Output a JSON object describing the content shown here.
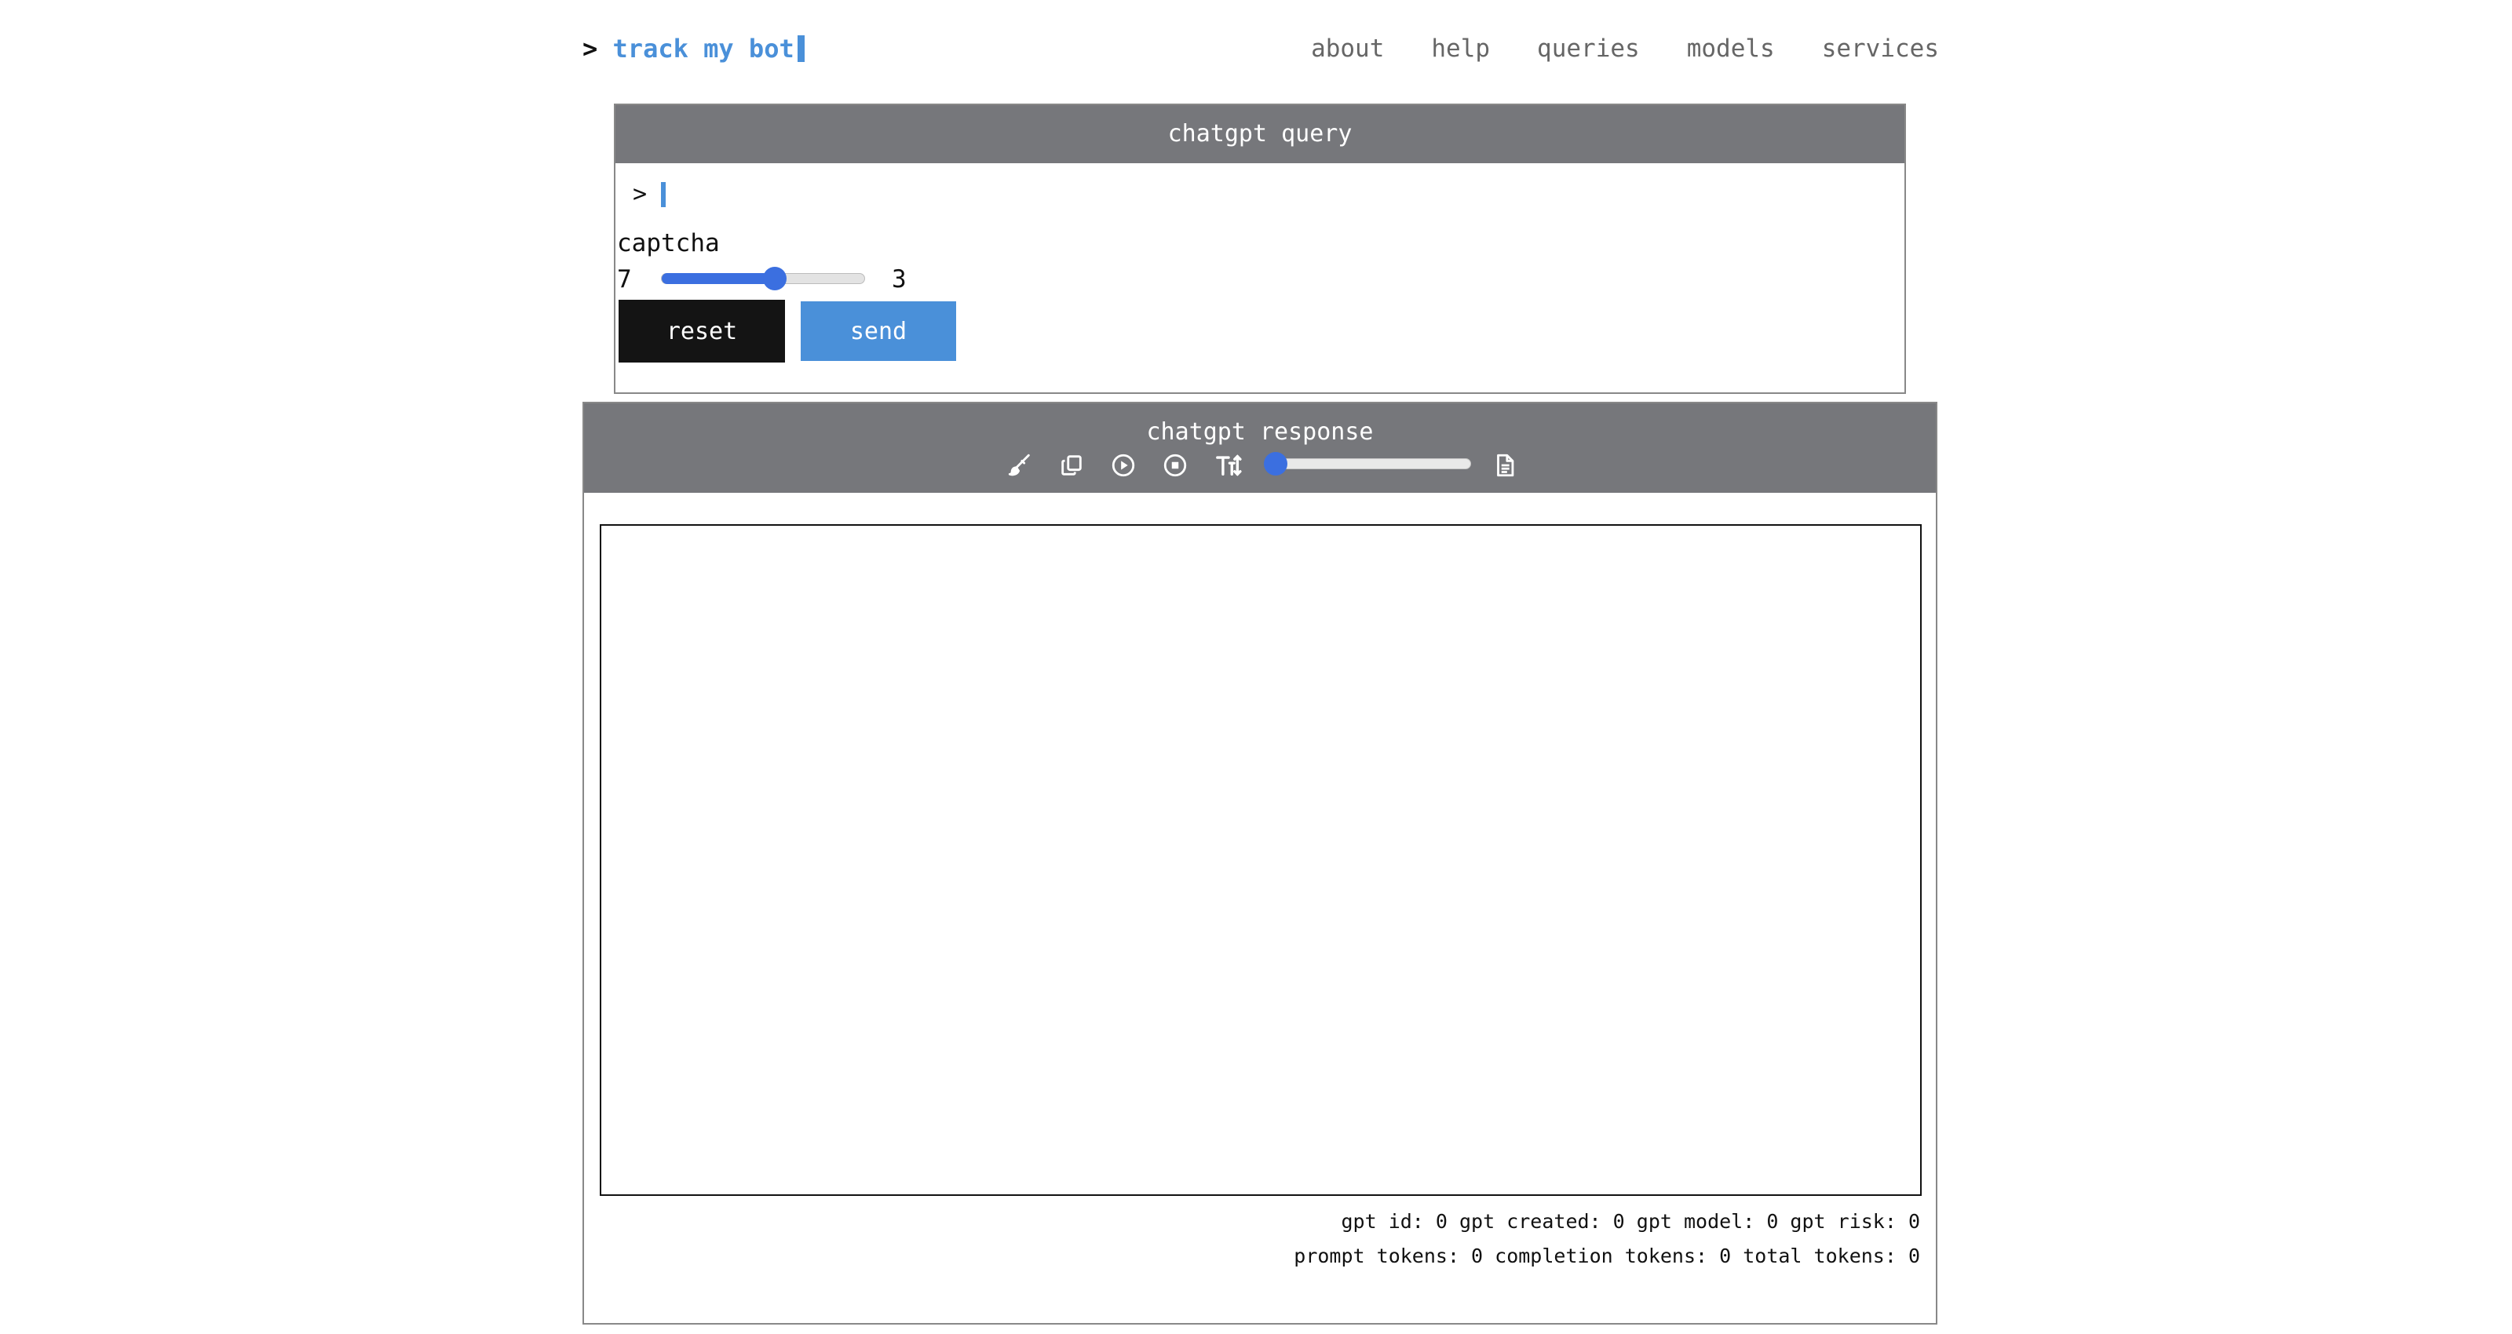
{
  "brand": {
    "prompt": ">",
    "name": "track my bot"
  },
  "nav": {
    "items": [
      "about",
      "help",
      "queries",
      "models",
      "services"
    ]
  },
  "query": {
    "title": "chatgpt query",
    "prompt": ">",
    "input_value": "",
    "captcha_label": "captcha",
    "captcha_left": "7",
    "captcha_right": "3",
    "captcha_slider_fraction": 0.56,
    "reset_label": "reset",
    "send_label": "send"
  },
  "response": {
    "title": "chatgpt response",
    "toolbar_icons": [
      "brush-icon",
      "copy-icon",
      "play-icon",
      "stop-icon",
      "text-size-icon",
      "document-icon"
    ],
    "font_slider_fraction": 0.0,
    "body_text": "",
    "stats_line1": "gpt id: 0 gpt created: 0 gpt model: 0 gpt risk: 0",
    "stats_line2": "prompt tokens: 0 completion tokens: 0 total tokens: 0"
  },
  "colors": {
    "accent": "#4a90d9",
    "slider": "#3b6fe0",
    "panel_header": "#76777b",
    "reset_button": "#141414"
  }
}
